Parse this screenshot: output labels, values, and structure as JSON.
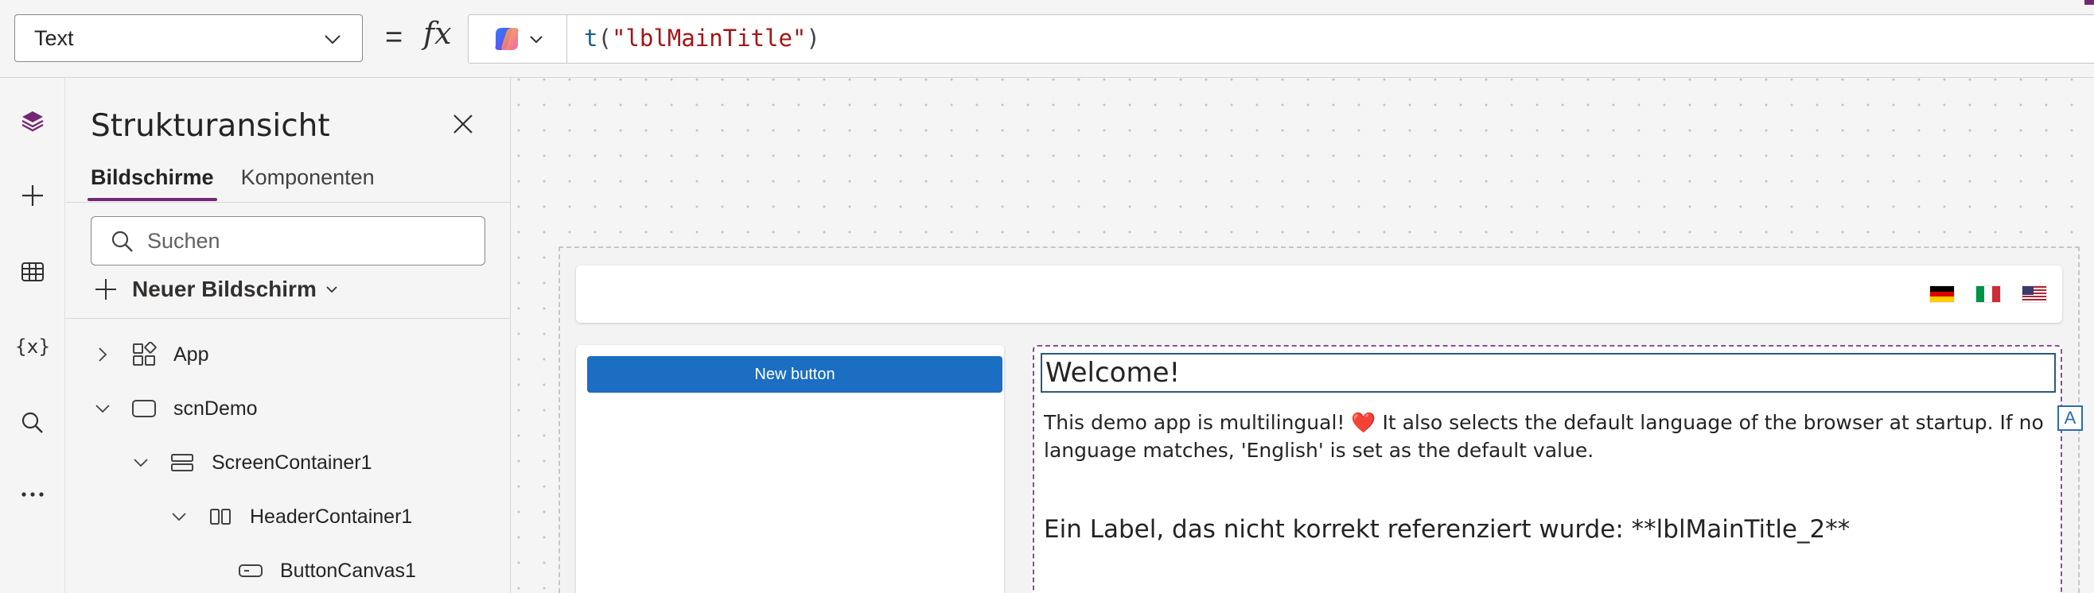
{
  "formula_bar": {
    "property": "Text",
    "equals": "=",
    "fx": "fx",
    "formula": {
      "fn": "t",
      "open": "(",
      "arg": "\"lblMainTitle\"",
      "close": ")"
    }
  },
  "tree_panel": {
    "title": "Strukturansicht",
    "tabs": [
      "Bildschirme",
      "Komponenten"
    ],
    "search_placeholder": "Suchen",
    "new_screen_label": "Neuer Bildschirm",
    "items": [
      {
        "label": "App",
        "icon": "app-icon"
      },
      {
        "label": "scnDemo",
        "icon": "screen-icon"
      },
      {
        "label": "ScreenContainer1",
        "icon": "vertical-container-icon"
      },
      {
        "label": "HeaderContainer1",
        "icon": "horizontal-container-icon"
      },
      {
        "label": "ButtonCanvas1",
        "icon": "button-icon"
      }
    ]
  },
  "canvas": {
    "button_label": "New button",
    "welcome": "Welcome!",
    "description_part1": "This demo app is multilingual! ",
    "heart": "❤️",
    "description_part2": " It also selects the default language of the browser at startup. If no language matches, 'English' is set as the default value.",
    "unreferenced_label": "Ein Label, das nicht korrekt referenziert wurde: **lblMainTitle_2**",
    "selection_handle": "A",
    "flags": [
      "flag-germany",
      "flag-italy",
      "flag-usa"
    ]
  },
  "colors": {
    "accent": "#742774",
    "button_blue": "#1b6ec2",
    "formula_string": "#a31515",
    "formula_function": "#1b5e8a"
  }
}
